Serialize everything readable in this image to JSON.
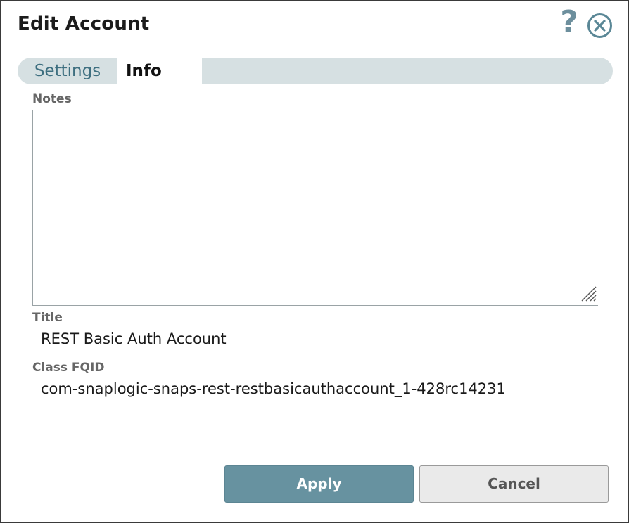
{
  "dialog": {
    "title": "Edit Account",
    "help_label": "?"
  },
  "tabs": [
    {
      "label": "Settings",
      "active": false
    },
    {
      "label": "Info",
      "active": true
    }
  ],
  "notes": {
    "label": "Notes",
    "value": ""
  },
  "title_field": {
    "label": "Title",
    "value": "REST Basic Auth Account"
  },
  "class_fqid": {
    "label": "Class FQID",
    "value": "com-snaplogic-snaps-rest-restbasicauthaccount_1-428rc14231"
  },
  "buttons": {
    "apply_label": "Apply",
    "cancel_label": "Cancel"
  },
  "icons": {
    "help": "question-mark-icon",
    "close": "circle-x-close-icon",
    "resize": "resize-grip-icon"
  },
  "colors": {
    "accent": "#6792a0",
    "tab_bar": "#d6e0e2",
    "tab_text": "#3e6f80",
    "help_icon": "#6d8f9d",
    "close_icon": "#5a8796"
  }
}
